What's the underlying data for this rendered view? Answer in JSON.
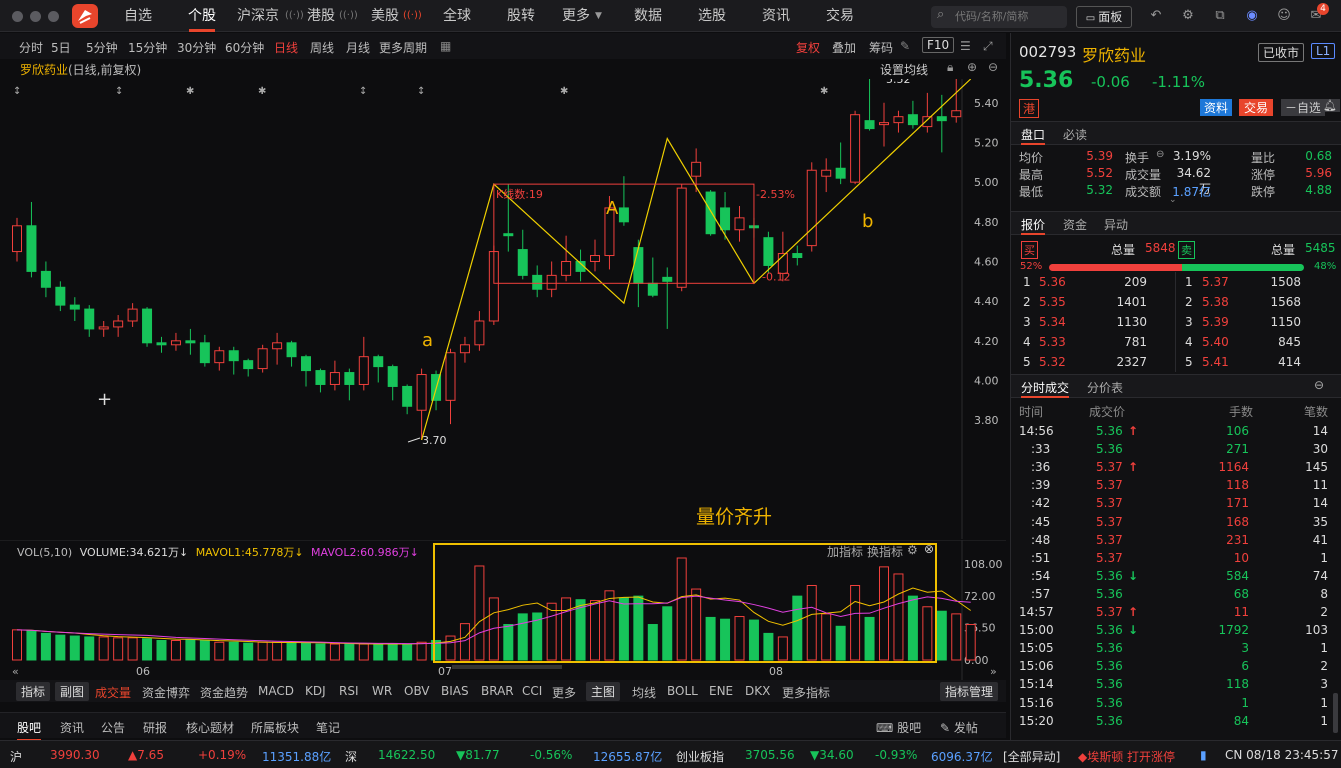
{
  "topbar": {
    "nav": [
      "自选",
      "个股",
      "沪深京",
      "港股",
      "美股",
      "全球",
      "股转",
      "更多",
      "数据",
      "选股",
      "资讯",
      "交易"
    ],
    "active": "个股",
    "search_placeholder": "代码/名称/简称",
    "panel_btn": "面板",
    "msg_count": "4",
    "icons": [
      "back-icon",
      "gear-icon",
      "share-icon",
      "avatar-icon",
      "user-icon",
      "message-icon"
    ]
  },
  "periods": {
    "items": [
      "分时",
      "5日",
      "5分钟",
      "15分钟",
      "30分钟",
      "60分钟",
      "日线",
      "周线",
      "月线",
      "更多周期"
    ],
    "active": "日线",
    "right": [
      "复权",
      "叠加",
      "筹码",
      "F10"
    ]
  },
  "stock_title": {
    "name": "罗欣药业",
    "mode": "(日线,前复权)",
    "ma_setting": "设置均线"
  },
  "chart": {
    "y_ticks": [
      "5.40",
      "5.20",
      "5.00",
      "4.80",
      "4.60",
      "4.40",
      "4.20",
      "4.00",
      "3.80"
    ],
    "annotations": {
      "a": "a",
      "A": "A",
      "b": "b",
      "kline_count": "K线数:19",
      "pct": "-2.53%",
      "diff": "-0.12",
      "low": "3.70",
      "high": "5.52",
      "slogan": "量价齐升"
    }
  },
  "chart_data": {
    "type": "candlestick",
    "title": "罗欣药业(日线,前复权)",
    "ylim": [
      3.7,
      5.52
    ],
    "candles": [
      {
        "o": 4.65,
        "c": 4.78,
        "h": 4.82,
        "l": 4.6
      },
      {
        "o": 4.78,
        "c": 4.55,
        "h": 4.9,
        "l": 4.52
      },
      {
        "o": 4.55,
        "c": 4.47,
        "h": 4.6,
        "l": 4.42
      },
      {
        "o": 4.47,
        "c": 4.38,
        "h": 4.5,
        "l": 4.35
      },
      {
        "o": 4.38,
        "c": 4.36,
        "h": 4.42,
        "l": 4.3
      },
      {
        "o": 4.36,
        "c": 4.26,
        "h": 4.38,
        "l": 4.22
      },
      {
        "o": 4.26,
        "c": 4.27,
        "h": 4.3,
        "l": 4.22
      },
      {
        "o": 4.27,
        "c": 4.3,
        "h": 4.33,
        "l": 4.22
      },
      {
        "o": 4.3,
        "c": 4.36,
        "h": 4.39,
        "l": 4.27
      },
      {
        "o": 4.36,
        "c": 4.19,
        "h": 4.37,
        "l": 4.17
      },
      {
        "o": 4.19,
        "c": 4.18,
        "h": 4.22,
        "l": 4.14
      },
      {
        "o": 4.18,
        "c": 4.2,
        "h": 4.24,
        "l": 4.15
      },
      {
        "o": 4.2,
        "c": 4.19,
        "h": 4.26,
        "l": 4.13
      },
      {
        "o": 4.19,
        "c": 4.09,
        "h": 4.23,
        "l": 4.07
      },
      {
        "o": 4.09,
        "c": 4.15,
        "h": 4.17,
        "l": 4.05
      },
      {
        "o": 4.15,
        "c": 4.1,
        "h": 4.17,
        "l": 4.03
      },
      {
        "o": 4.1,
        "c": 4.06,
        "h": 4.11,
        "l": 4.02
      },
      {
        "o": 4.06,
        "c": 4.16,
        "h": 4.18,
        "l": 4.04
      },
      {
        "o": 4.16,
        "c": 4.19,
        "h": 4.24,
        "l": 4.08
      },
      {
        "o": 4.19,
        "c": 4.12,
        "h": 4.2,
        "l": 4.07
      },
      {
        "o": 4.12,
        "c": 4.05,
        "h": 4.13,
        "l": 3.97
      },
      {
        "o": 4.05,
        "c": 3.98,
        "h": 4.06,
        "l": 3.94
      },
      {
        "o": 3.98,
        "c": 4.04,
        "h": 4.1,
        "l": 3.95
      },
      {
        "o": 4.04,
        "c": 3.98,
        "h": 4.06,
        "l": 3.9
      },
      {
        "o": 3.98,
        "c": 4.12,
        "h": 4.22,
        "l": 3.95
      },
      {
        "o": 4.12,
        "c": 4.07,
        "h": 4.13,
        "l": 3.99
      },
      {
        "o": 4.07,
        "c": 3.97,
        "h": 4.08,
        "l": 3.9
      },
      {
        "o": 3.97,
        "c": 3.87,
        "h": 3.98,
        "l": 3.83
      },
      {
        "o": 3.85,
        "c": 4.03,
        "h": 4.06,
        "l": 3.7
      },
      {
        "o": 4.03,
        "c": 3.9,
        "h": 4.05,
        "l": 3.85
      },
      {
        "o": 3.9,
        "c": 4.14,
        "h": 4.16,
        "l": 3.78
      },
      {
        "o": 4.14,
        "c": 4.18,
        "h": 4.22,
        "l": 4.09
      },
      {
        "o": 4.18,
        "c": 4.3,
        "h": 4.35,
        "l": 4.15
      },
      {
        "o": 4.3,
        "c": 4.65,
        "h": 4.68,
        "l": 4.28
      },
      {
        "o": 4.74,
        "c": 4.73,
        "h": 4.99,
        "l": 4.65
      },
      {
        "o": 4.66,
        "c": 4.53,
        "h": 4.76,
        "l": 4.51
      },
      {
        "o": 4.53,
        "c": 4.46,
        "h": 4.58,
        "l": 4.42
      },
      {
        "o": 4.46,
        "c": 4.53,
        "h": 4.6,
        "l": 4.42
      },
      {
        "o": 4.53,
        "c": 4.6,
        "h": 4.73,
        "l": 4.5
      },
      {
        "o": 4.6,
        "c": 4.55,
        "h": 4.66,
        "l": 4.5
      },
      {
        "o": 4.6,
        "c": 4.63,
        "h": 4.71,
        "l": 4.55
      },
      {
        "o": 4.63,
        "c": 4.87,
        "h": 4.93,
        "l": 4.56
      },
      {
        "o": 4.87,
        "c": 4.8,
        "h": 5.03,
        "l": 4.78
      },
      {
        "o": 4.67,
        "c": 4.49,
        "h": 4.71,
        "l": 4.37
      },
      {
        "o": 4.49,
        "c": 4.43,
        "h": 4.62,
        "l": 4.42
      },
      {
        "o": 4.52,
        "c": 4.5,
        "h": 4.57,
        "l": 4.26
      },
      {
        "o": 4.47,
        "c": 4.97,
        "h": 4.99,
        "l": 4.45
      },
      {
        "o": 5.03,
        "c": 5.1,
        "h": 5.17,
        "l": 4.95
      },
      {
        "o": 4.95,
        "c": 4.74,
        "h": 4.96,
        "l": 4.73
      },
      {
        "o": 4.87,
        "c": 4.76,
        "h": 4.95,
        "l": 4.71
      },
      {
        "o": 4.76,
        "c": 4.82,
        "h": 4.88,
        "l": 4.7
      },
      {
        "o": 4.78,
        "c": 4.77,
        "h": 4.82,
        "l": 4.72
      },
      {
        "o": 4.72,
        "c": 4.58,
        "h": 4.75,
        "l": 4.54
      },
      {
        "o": 4.54,
        "c": 4.64,
        "h": 4.75,
        "l": 4.5
      },
      {
        "o": 4.64,
        "c": 4.62,
        "h": 4.68,
        "l": 4.58
      },
      {
        "o": 4.68,
        "c": 5.06,
        "h": 5.1,
        "l": 4.65
      },
      {
        "o": 5.03,
        "c": 5.06,
        "h": 5.12,
        "l": 4.95
      },
      {
        "o": 5.07,
        "c": 5.02,
        "h": 5.2,
        "l": 4.99
      },
      {
        "o": 5.0,
        "c": 5.34,
        "h": 5.36,
        "l": 4.99
      },
      {
        "o": 5.31,
        "c": 5.27,
        "h": 5.52,
        "l": 5.26
      },
      {
        "o": 5.29,
        "c": 5.3,
        "h": 5.4,
        "l": 5.18
      },
      {
        "o": 5.3,
        "c": 5.33,
        "h": 5.36,
        "l": 5.25
      },
      {
        "o": 5.34,
        "c": 5.29,
        "h": 5.41,
        "l": 5.27
      },
      {
        "o": 5.28,
        "c": 5.33,
        "h": 5.45,
        "l": 5.25
      },
      {
        "o": 5.33,
        "c": 5.31,
        "h": 5.44,
        "l": 5.15
      },
      {
        "o": 5.33,
        "c": 5.36,
        "h": 5.52,
        "l": 5.3
      }
    ],
    "volume": {
      "label": "VOL(5,10)",
      "volume": "VOLUME:34.621万",
      "mavol1": "MAVOL1:45.778万",
      "mavol2": "MAVOL2:60.986万",
      "y_ticks": [
        "108.00",
        "72.00",
        "36.50",
        "0.00"
      ],
      "values": [
        34,
        33,
        30,
        28,
        27,
        26,
        26,
        25,
        25,
        24,
        22,
        22,
        23,
        22,
        20,
        20,
        19,
        20,
        20,
        20,
        19,
        18,
        18,
        18,
        18,
        18,
        18,
        18,
        20,
        22,
        27,
        41,
        106,
        70,
        40,
        52,
        53,
        64,
        70,
        68,
        67,
        78,
        70,
        72,
        40,
        60,
        115,
        80,
        48,
        46,
        49,
        45,
        30,
        26,
        72,
        84,
        52,
        38,
        84,
        48,
        105,
        97,
        72,
        60,
        55,
        52,
        40
      ],
      "x_labels": [
        "06",
        "07",
        "08"
      ]
    },
    "x_labels": [
      "06",
      "07",
      "08"
    ]
  },
  "ind_bar": {
    "left": [
      "指标",
      "副图",
      "成交量",
      "资金博弈",
      "资金趋势",
      "MACD",
      "KDJ",
      "RSI",
      "WR",
      "OBV",
      "BIAS",
      "BRAR",
      "CCI",
      "更多"
    ],
    "main": [
      "主图",
      "均线",
      "BOLL",
      "ENE",
      "DKX",
      "更多指标"
    ],
    "manage": "指标管理",
    "overlay": [
      "加指标",
      "换指标"
    ]
  },
  "bottom_tabs": {
    "items": [
      "股吧",
      "资讯",
      "公告",
      "研报",
      "核心题材",
      "所属板块",
      "笔记"
    ],
    "right": [
      "股吧",
      "发帖"
    ]
  },
  "status": {
    "sh": "沪",
    "sh_idx": "3990.30",
    "sh_chg": "▲7.65",
    "sh_pct": "+0.19%",
    "sh_amt": "11351.88亿",
    "sz": "深",
    "sz_idx": "14622.50",
    "sz_chg": "▼81.77",
    "sz_pct": "-0.56%",
    "sz_amt": "12655.87亿",
    "cyb": "创业板指",
    "cyb_idx": "3705.56",
    "cyb_chg": "▼34.60",
    "cyb_pct": "-0.93%",
    "cyb_amt": "6096.37亿",
    "all": "[全部异动]",
    "news": "◆埃斯顿 打开涨停",
    "clock": "CN 08/18 23:45:57"
  },
  "quote": {
    "code": "002793",
    "name": "罗欣药业",
    "status": "已收市",
    "level": "L1",
    "price": "5.36",
    "chg": "-0.06",
    "pct": "-1.11%",
    "hk": "港",
    "btns": [
      "资料",
      "交易",
      "－自选"
    ],
    "tabs": [
      "盘口",
      "必读"
    ],
    "stats": [
      [
        "均价",
        "5.39",
        "换手",
        "3.19%",
        "量比",
        "0.68"
      ],
      [
        "最高",
        "5.52",
        "成交量",
        "34.62万",
        "涨停",
        "5.96"
      ],
      [
        "最低",
        "5.32",
        "成交额",
        "1.87亿",
        "跌停",
        "4.88"
      ]
    ]
  },
  "orderbook": {
    "tabs": [
      "报价",
      "资金",
      "异动"
    ],
    "buy_label": "买",
    "sell_label": "卖",
    "buy_total_label": "总量",
    "buy_total": "5848",
    "sell_total_label": "总量",
    "sell_total": "5485",
    "buy_pct": "52%",
    "sell_pct": "48%",
    "bids": [
      [
        "1",
        "5.36",
        "209"
      ],
      [
        "2",
        "5.35",
        "1401"
      ],
      [
        "3",
        "5.34",
        "1130"
      ],
      [
        "4",
        "5.33",
        "781"
      ],
      [
        "5",
        "5.32",
        "2327"
      ]
    ],
    "asks": [
      [
        "1",
        "5.37",
        "1508"
      ],
      [
        "2",
        "5.38",
        "1568"
      ],
      [
        "3",
        "5.39",
        "1150"
      ],
      [
        "4",
        "5.40",
        "845"
      ],
      [
        "5",
        "5.41",
        "414"
      ]
    ]
  },
  "trades": {
    "tabs": [
      "分时成交",
      "分价表"
    ],
    "headers": [
      "时间",
      "成交价",
      "手数",
      "笔数"
    ],
    "rows": [
      [
        "14:56",
        "5.36",
        "↑",
        "106",
        "14"
      ],
      [
        ":33",
        "5.36",
        "",
        "271",
        "30"
      ],
      [
        ":36",
        "5.37",
        "↑",
        "1164",
        "145"
      ],
      [
        ":39",
        "5.37",
        "",
        "118",
        "11"
      ],
      [
        ":42",
        "5.37",
        "",
        "171",
        "14"
      ],
      [
        ":45",
        "5.37",
        "",
        "168",
        "35"
      ],
      [
        ":48",
        "5.37",
        "",
        "231",
        "41"
      ],
      [
        ":51",
        "5.37",
        "",
        "10",
        "1"
      ],
      [
        ":54",
        "5.36",
        "↓",
        "584",
        "74"
      ],
      [
        ":57",
        "5.36",
        "",
        "68",
        "8"
      ],
      [
        "14:57",
        "5.37",
        "↑",
        "11",
        "2"
      ],
      [
        "15:00",
        "5.36",
        "↓",
        "1792",
        "103"
      ],
      [
        "15:05",
        "5.36",
        "",
        "3",
        "1"
      ],
      [
        "15:06",
        "5.36",
        "",
        "6",
        "2"
      ],
      [
        "15:14",
        "5.36",
        "",
        "118",
        "3"
      ],
      [
        "15:16",
        "5.36",
        "",
        "1",
        "1"
      ],
      [
        "15:20",
        "5.36",
        "",
        "84",
        "1"
      ]
    ]
  }
}
